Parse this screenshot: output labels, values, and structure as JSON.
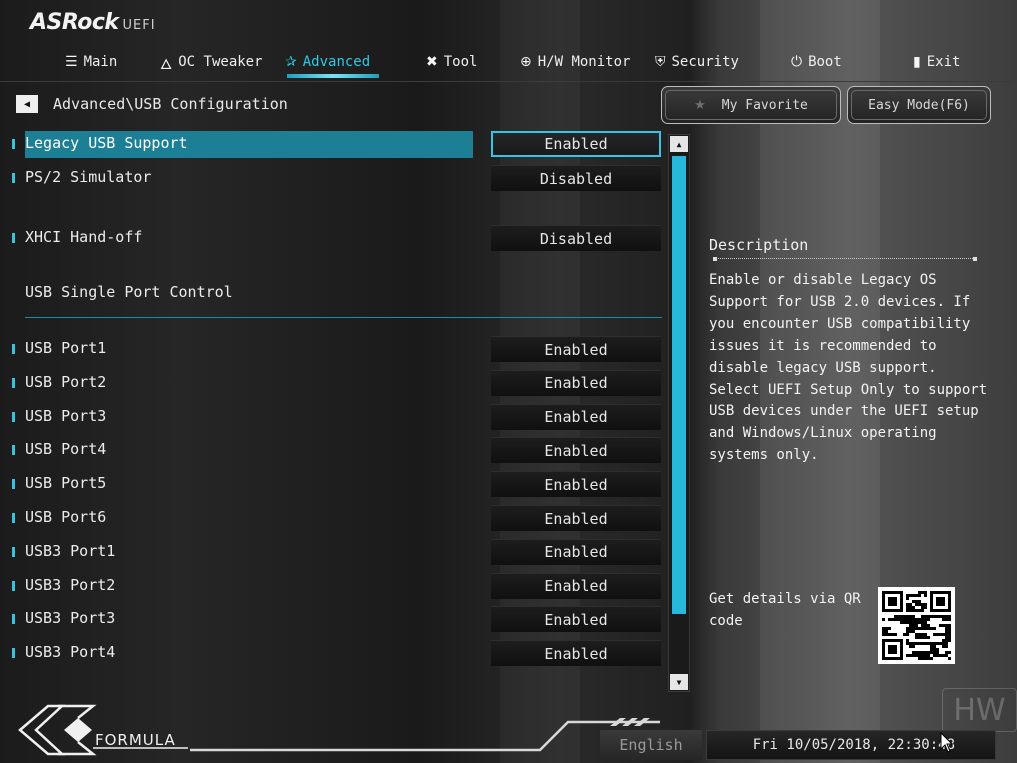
{
  "brand": {
    "name": "ASRock",
    "suffix": "UEFI"
  },
  "tabs": [
    {
      "label": "Main",
      "icon": "list-icon",
      "glyph": "☰"
    },
    {
      "label": "OC Tweaker",
      "icon": "flame-icon",
      "glyph": "🜂"
    },
    {
      "label": "Advanced",
      "icon": "star-icon",
      "glyph": "✰"
    },
    {
      "label": "Tool",
      "icon": "tools-icon",
      "glyph": "✖"
    },
    {
      "label": "H/W Monitor",
      "icon": "monitor-icon",
      "glyph": "⊕"
    },
    {
      "label": "Security",
      "icon": "shield-icon",
      "glyph": "⛨"
    },
    {
      "label": "Boot",
      "icon": "power-icon",
      "glyph": "⏻"
    },
    {
      "label": "Exit",
      "icon": "exit-icon",
      "glyph": "▮"
    }
  ],
  "active_tab": "Advanced",
  "breadcrumb": "Advanced\\USB Configuration",
  "top_buttons": {
    "favorite": "My Favorite",
    "easy_mode": "Easy Mode(F6)"
  },
  "settings": [
    {
      "label": "Legacy USB Support",
      "value": "Enabled",
      "selected": true
    },
    {
      "label": "PS/2 Simulator",
      "value": "Disabled"
    },
    {
      "label": "XHCI Hand-off",
      "value": "Disabled"
    }
  ],
  "section_title": "USB Single Port Control",
  "ports": [
    {
      "label": "USB Port1",
      "value": "Enabled"
    },
    {
      "label": "USB Port2",
      "value": "Enabled"
    },
    {
      "label": "USB Port3",
      "value": "Enabled"
    },
    {
      "label": "USB Port4",
      "value": "Enabled"
    },
    {
      "label": "USB Port5",
      "value": "Enabled"
    },
    {
      "label": "USB Port6",
      "value": "Enabled"
    },
    {
      "label": "USB3 Port1",
      "value": "Enabled"
    },
    {
      "label": "USB3 Port2",
      "value": "Enabled"
    },
    {
      "label": "USB3 Port3",
      "value": "Enabled"
    },
    {
      "label": "USB3 Port4",
      "value": "Enabled"
    }
  ],
  "description": {
    "title": "Description",
    "text": "Enable or disable Legacy OS\nSupport for USB 2.0 devices. If\nyou encounter USB compatibility\nissues it is recommended to\ndisable legacy USB support.\nSelect UEFI Setup Only to support\nUSB devices under the UEFI setup\nand Windows/Linux operating\nsystems only."
  },
  "qr": {
    "label": "Get details via QR code"
  },
  "footer": {
    "logo_text": "FORMULA",
    "language": "English",
    "datetime": "Fri 10/05/2018, 22:30:48"
  },
  "watermark": "HW",
  "colors": {
    "accent": "#2ec8e6",
    "selection": "#1c7f95",
    "scroll_thumb": "#27b8dc"
  }
}
